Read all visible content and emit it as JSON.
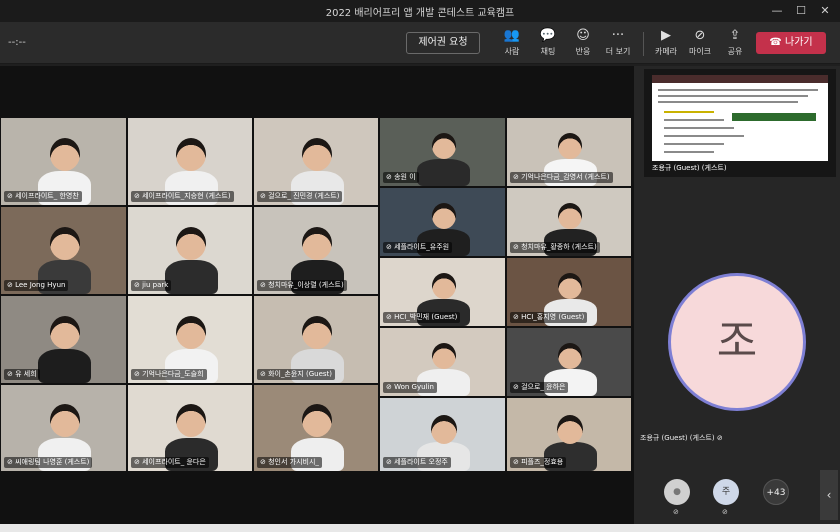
{
  "window": {
    "title": "2022 배리어프리 앱 개발 콘테스트 교육캠프"
  },
  "meeting": {
    "timer": "--:--",
    "request_control": "제어권 요청"
  },
  "toolbar": [
    {
      "label": "사람",
      "icon": "people-icon"
    },
    {
      "label": "채팅",
      "icon": "chat-icon"
    },
    {
      "label": "반응",
      "icon": "reaction-icon"
    },
    {
      "label": "더 보기",
      "icon": "more-icon"
    },
    {
      "label": "카메라",
      "icon": "camera-icon"
    },
    {
      "label": "마이크",
      "icon": "mic-off-icon"
    },
    {
      "label": "공유",
      "icon": "share-icon"
    }
  ],
  "leave_button": "나가기",
  "participants": [
    "세이프라이트_ 한영찬",
    "세이프라이트_지승현 (게스트)",
    "걸으로_ 진민경 (게스트)",
    "송원 이",
    "기억나은다금_감영서 (게스트)",
    "Lee Jong Hyun",
    "jiu park",
    "청치마유_이상렬 (게스트)",
    "세플라이트_유주원",
    "청치마유_황종하 (게스트)",
    "HCI_박민재 (Guest)",
    "HCI_홍지영 (Guest)",
    "유 세희",
    "기억나은다금_도슬희",
    "화이_손윤지 (Guest)",
    "Won Gyulin",
    "걸으로_ 윤하은",
    "씨애링팀 나영훈 (게스트)",
    "세이프라이트_ 윤다은",
    "청인서 가시비시_",
    "세플라이트 오정주",
    "피플즈_정효용"
  ],
  "sidebar": {
    "share_owner": "조용규 (Guest) (게스트)",
    "avatar_initial": "조",
    "avatar_name": "조용규 (Guest) (게스트)",
    "overflow_count": "+43",
    "mini_initial": "주"
  },
  "colors": {
    "leave": "#c4314b",
    "avatar_ring": "#7e7fd4",
    "avatar_bg": "#f7d9da"
  }
}
